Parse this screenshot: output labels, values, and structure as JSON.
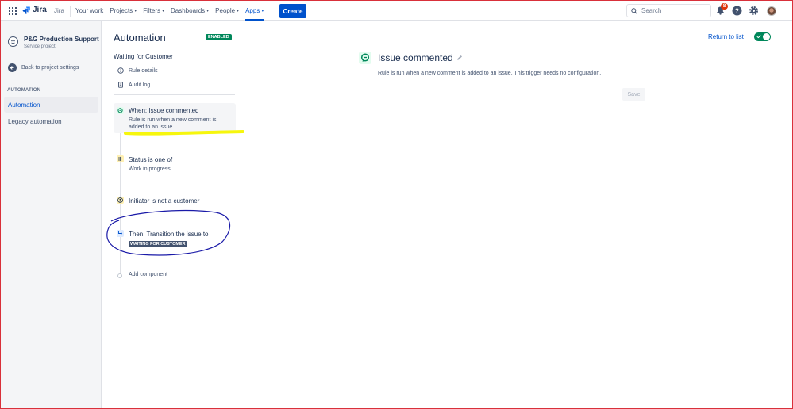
{
  "topnav": {
    "logo_text": "Jira",
    "product_label": "Jira",
    "items": [
      {
        "label": "Your work",
        "dropdown": false
      },
      {
        "label": "Projects",
        "dropdown": true
      },
      {
        "label": "Filters",
        "dropdown": true
      },
      {
        "label": "Dashboards",
        "dropdown": true
      },
      {
        "label": "People",
        "dropdown": true
      },
      {
        "label": "Apps",
        "dropdown": true
      }
    ],
    "create_label": "Create",
    "search_placeholder": "Search",
    "notification_count": "8"
  },
  "sidebar": {
    "project_name": "P&G Production Support",
    "project_type": "Service project",
    "back_label": "Back to project settings",
    "section_label": "AUTOMATION",
    "items": [
      {
        "label": "Automation",
        "active": true
      },
      {
        "label": "Legacy automation",
        "active": false
      }
    ]
  },
  "main": {
    "title": "Automation",
    "status_badge": "ENABLED",
    "rule_name": "Waiting for Customer",
    "menu": [
      {
        "label": "Rule details",
        "icon": "info-icon"
      },
      {
        "label": "Audit log",
        "icon": "document-icon"
      }
    ],
    "steps": [
      {
        "title": "When: Issue commented",
        "subtitle_line1": "Rule is run when a new comment is",
        "subtitle_line2": "added to an issue.",
        "icon": "comment-icon"
      },
      {
        "title": "Status is one of",
        "subtitle": "Work in progress",
        "icon": "shuffle-icon"
      },
      {
        "title": "Initiator is not a customer",
        "icon": "user-icon"
      },
      {
        "title": "Then: Transition the issue to",
        "status": "WAITING FOR CUSTOMER",
        "icon": "transition-icon"
      }
    ],
    "add_component_label": "Add component"
  },
  "detail": {
    "title": "Issue commented",
    "description": "Rule is run when a new comment is added to an issue. This trigger needs no configuration.",
    "save_label": "Save"
  },
  "header_actions": {
    "return_label": "Return to list",
    "toggle_on": true
  },
  "colors": {
    "brand_blue": "#0052cc",
    "enabled_green": "#00875a",
    "highlight_yellow": "#f5f500",
    "annotation_blue": "#1a1aa8",
    "frame_red": "#d9303a"
  }
}
